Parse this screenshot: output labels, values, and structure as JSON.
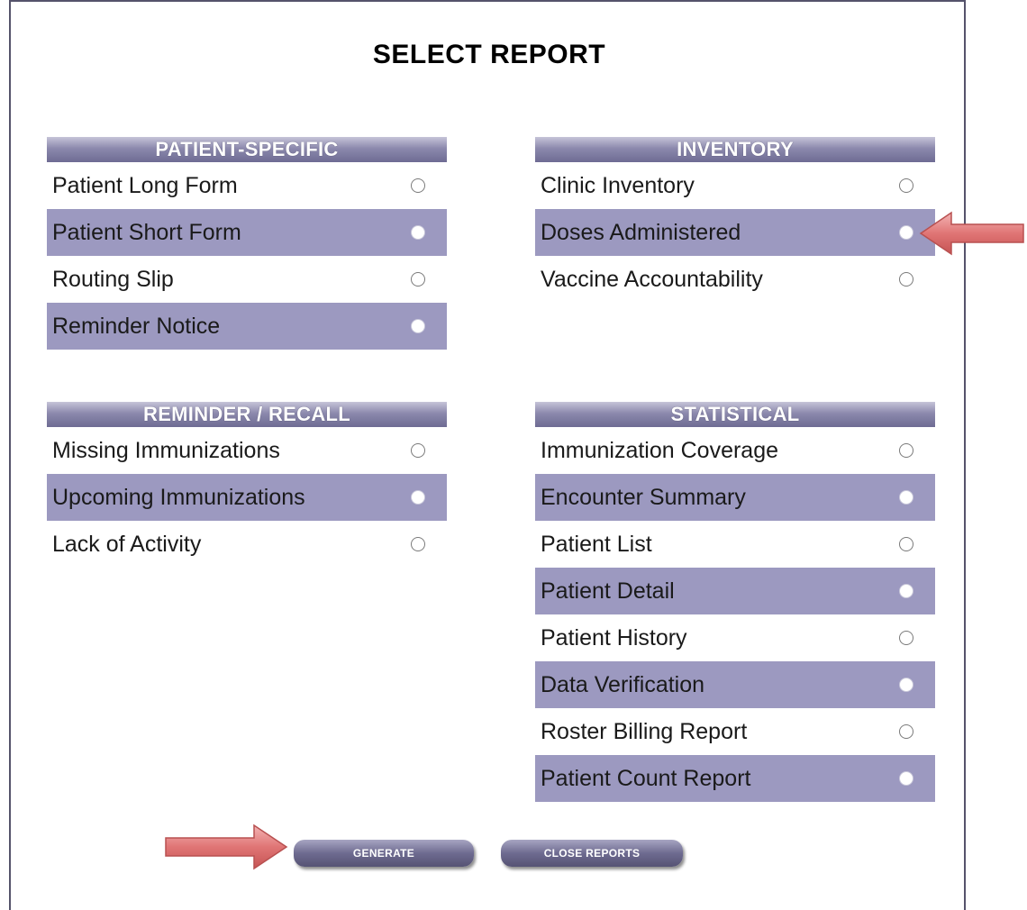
{
  "title": "SELECT REPORT",
  "sections": {
    "patient_specific": {
      "header": "PATIENT-SPECIFIC",
      "items": [
        {
          "label": "Patient Long Form"
        },
        {
          "label": "Patient Short Form"
        },
        {
          "label": "Routing Slip"
        },
        {
          "label": "Reminder Notice"
        }
      ]
    },
    "inventory": {
      "header": "INVENTORY",
      "items": [
        {
          "label": "Clinic Inventory"
        },
        {
          "label": "Doses Administered"
        },
        {
          "label": "Vaccine Accountability"
        }
      ]
    },
    "reminder_recall": {
      "header": "REMINDER / RECALL",
      "items": [
        {
          "label": "Missing Immunizations"
        },
        {
          "label": "Upcoming Immunizations"
        },
        {
          "label": "Lack of Activity"
        }
      ]
    },
    "statistical": {
      "header": "STATISTICAL",
      "items": [
        {
          "label": "Immunization Coverage"
        },
        {
          "label": "Encounter Summary"
        },
        {
          "label": "Patient List"
        },
        {
          "label": "Patient Detail"
        },
        {
          "label": "Patient History"
        },
        {
          "label": "Data Verification"
        },
        {
          "label": "Roster Billing Report"
        },
        {
          "label": "Patient Count Report"
        }
      ]
    }
  },
  "buttons": {
    "generate": "GENERATE",
    "close_reports": "CLOSE REPORTS"
  },
  "colors": {
    "row_shade": "#9c99c0",
    "header_gradient_mid": "#8c89ad",
    "arrow_fill": "#e07575"
  },
  "icons": {
    "radio": "radio-button-icon",
    "arrow": "pointer-arrow-icon"
  }
}
